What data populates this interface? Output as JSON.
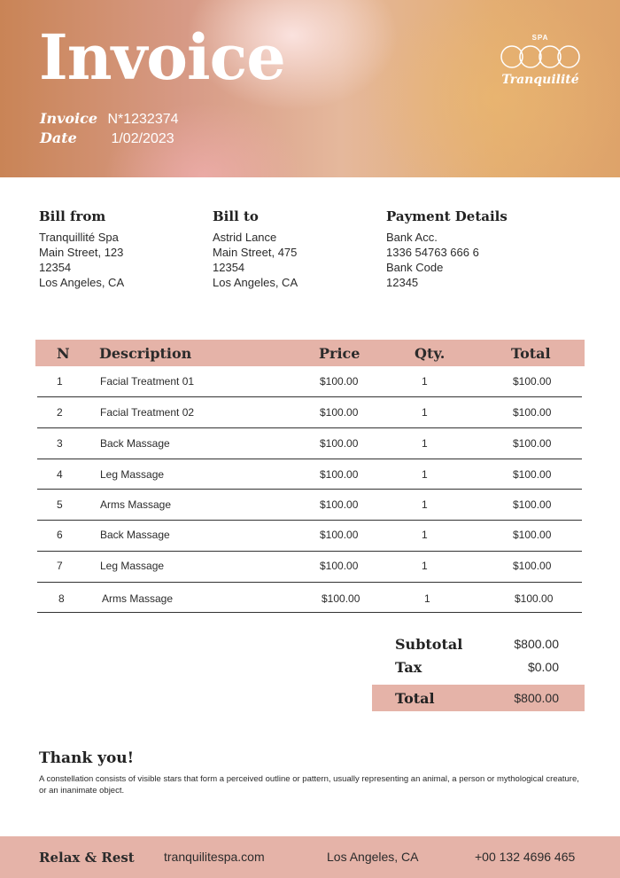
{
  "header": {
    "title": "Invoice",
    "invoice_label": "Invoice",
    "invoice_number": "N*1232374",
    "date_label": "Date",
    "date_value": "1/02/2023",
    "logo": {
      "small_text": "SPA",
      "brand": "Tranquilité",
      "icon": "interlocking-rings-logo"
    }
  },
  "bill_from": {
    "heading": "Bill from",
    "lines": [
      "Tranquillité Spa",
      "Main Street, 123",
      "12354",
      "Los Angeles, CA"
    ]
  },
  "bill_to": {
    "heading": "Bill to",
    "lines": [
      "Astrid Lance",
      "Main Street, 475",
      "12354",
      "Los Angeles, CA"
    ]
  },
  "payment": {
    "heading": "Payment Details",
    "lines": [
      "Bank Acc.",
      "1336 54763 666 6",
      "Bank Code",
      "12345"
    ]
  },
  "table": {
    "headers": {
      "n": "N",
      "description": "Description",
      "price": "Price",
      "qty": "Qty.",
      "total": "Total"
    },
    "rows": [
      {
        "n": "1",
        "description": "Facial Treatment 01",
        "price": "$100.00",
        "qty": "1",
        "total": "$100.00"
      },
      {
        "n": "2",
        "description": "Facial Treatment 02",
        "price": "$100.00",
        "qty": "1",
        "total": "$100.00"
      },
      {
        "n": "3",
        "description": "Back Massage",
        "price": "$100.00",
        "qty": "1",
        "total": "$100.00"
      },
      {
        "n": "4",
        "description": "Leg Massage",
        "price": "$100.00",
        "qty": "1",
        "total": "$100.00"
      },
      {
        "n": "5",
        "description": "Arms Massage",
        "price": "$100.00",
        "qty": "1",
        "total": "$100.00"
      },
      {
        "n": "6",
        "description": "Back Massage",
        "price": "$100.00",
        "qty": "1",
        "total": "$100.00"
      },
      {
        "n": "7",
        "description": "Leg Massage",
        "price": "$100.00",
        "qty": "1",
        "total": "$100.00"
      },
      {
        "n": "8",
        "description": "Arms Massage",
        "price": "$100.00",
        "qty": "1",
        "total": "$100.00"
      }
    ]
  },
  "totals": {
    "subtotal_label": "Subtotal",
    "subtotal_value": "$800.00",
    "tax_label": "Tax",
    "tax_value": "$0.00",
    "total_label": "Total",
    "total_value": "$800.00"
  },
  "thanks": {
    "heading": "Thank you!",
    "text": "A constellation consists of visible stars that form a perceived outline or pattern, usually representing an animal, a person or mythological creature, or an inanimate object."
  },
  "footer": {
    "tagline": "Relax & Rest",
    "website": "tranquilitespa.com",
    "location": "Los Angeles, CA",
    "phone": "+00 132 4696 465"
  },
  "colors": {
    "accent": "#e5b3a8",
    "header_left": "#c98456",
    "header_right": "#e3ad72"
  }
}
